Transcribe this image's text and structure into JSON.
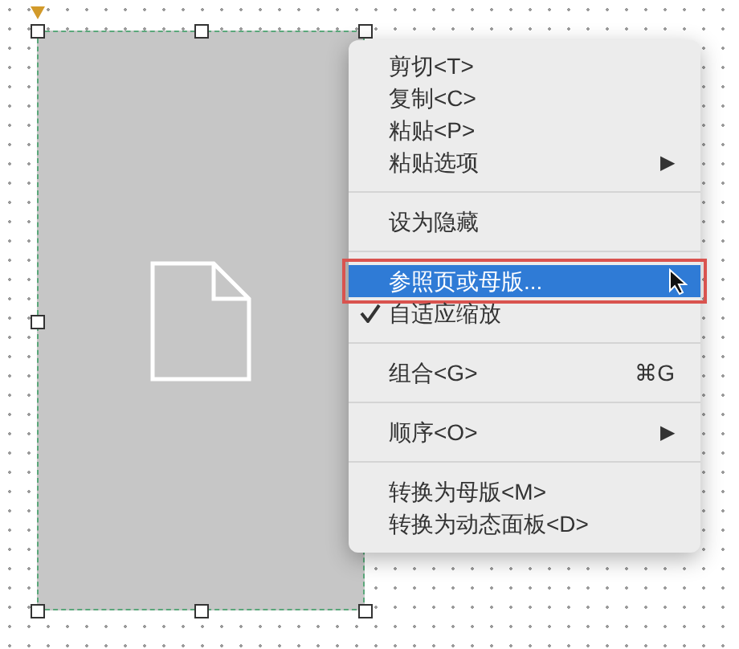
{
  "context_menu": {
    "groups": [
      {
        "items": [
          {
            "label": "剪切<T>",
            "checked": false,
            "selected": false
          },
          {
            "label": "复制<C>",
            "checked": false,
            "selected": false
          },
          {
            "label": "粘贴<P>",
            "checked": false,
            "selected": false
          },
          {
            "label": "粘贴选项",
            "arrow": "▶",
            "checked": false,
            "selected": false
          }
        ]
      },
      {
        "items": [
          {
            "label": "设为隐藏",
            "checked": false,
            "selected": false
          }
        ]
      },
      {
        "items": [
          {
            "label": "参照页或母版...",
            "checked": false,
            "selected": true
          },
          {
            "label": "自适应缩放",
            "checked": true,
            "selected": false
          }
        ]
      },
      {
        "items": [
          {
            "label": "组合<G>",
            "shortcut": "⌘G",
            "checked": false,
            "selected": false
          }
        ]
      },
      {
        "items": [
          {
            "label": "顺序<O>",
            "arrow": "▶",
            "checked": false,
            "selected": false
          }
        ]
      },
      {
        "items": [
          {
            "label": "转换为母版<M>",
            "checked": false,
            "selected": false
          },
          {
            "label": "转换为动态面板<D>",
            "checked": false,
            "selected": false
          }
        ]
      }
    ]
  }
}
